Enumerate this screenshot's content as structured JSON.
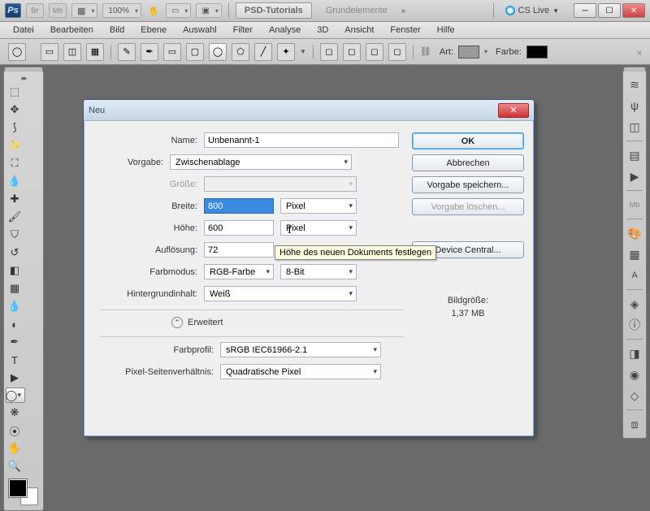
{
  "appbar": {
    "logo": "Ps",
    "btn_br": "Br",
    "btn_mb": "Mb",
    "zoom": "100%",
    "tab_active": "PSD-Tutorials",
    "tab_inactive": "Grundelemente",
    "cslive": "CS Live"
  },
  "menu": [
    "Datei",
    "Bearbeiten",
    "Bild",
    "Ebene",
    "Auswahl",
    "Filter",
    "Analyse",
    "3D",
    "Ansicht",
    "Fenster",
    "Hilfe"
  ],
  "optbar": {
    "art_label": "Art:",
    "farbe_label": "Farbe:"
  },
  "dialog": {
    "title": "Neu",
    "name_label": "Name:",
    "name_value": "Unbenannt-1",
    "preset_label": "Vorgabe:",
    "preset_value": "Zwischenablage",
    "size_label": "Größe:",
    "width_label": "Breite:",
    "width_value": "800",
    "width_unit": "Pixel",
    "height_label": "Höhe:",
    "height_value": "600",
    "height_unit": "Pixel",
    "res_label": "Auflösung:",
    "res_value": "72",
    "mode_label": "Farbmodus:",
    "mode_value": "RGB-Farbe",
    "bit_value": "8-Bit",
    "bgcontent_label": "Hintergrundinhalt:",
    "bgcontent_value": "Weiß",
    "advanced": "Erweitert",
    "profile_label": "Farbprofil:",
    "profile_value": "sRGB IEC61966-2.1",
    "par_label": "Pixel-Seitenverhältnis:",
    "par_value": "Quadratische Pixel",
    "btn_ok": "OK",
    "btn_cancel": "Abbrechen",
    "btn_save_preset": "Vorgabe speichern...",
    "btn_del_preset": "Vorgabe löschen...",
    "btn_device": "Device Central...",
    "imgsize_label": "Bildgröße:",
    "imgsize_value": "1,37 MB",
    "tooltip": "Höhe des neuen Dokuments festlegen"
  }
}
